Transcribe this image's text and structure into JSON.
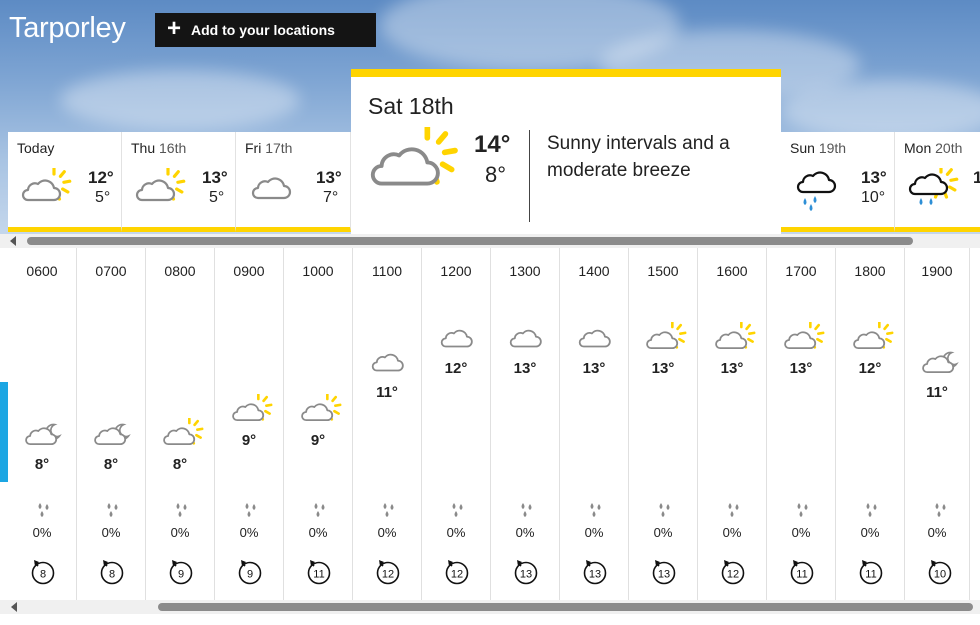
{
  "header": {
    "location_title": "Tarporley",
    "add_button_label": "Add to your locations"
  },
  "days": [
    {
      "name": "Today",
      "date": "",
      "high": "12°",
      "low": "5°",
      "icon": "sunny-intervals-icon"
    },
    {
      "name": "Thu",
      "date": "16th",
      "high": "13°",
      "low": "5°",
      "icon": "sunny-intervals-icon"
    },
    {
      "name": "Fri",
      "date": "17th",
      "high": "13°",
      "low": "7°",
      "icon": "cloud-icon"
    },
    {
      "name": "Sun",
      "date": "19th",
      "high": "13°",
      "low": "10°",
      "icon": "rain-icon"
    },
    {
      "name": "Mon",
      "date": "20th",
      "high": "1",
      "low": "",
      "icon": "sunny-rain-icon"
    }
  ],
  "selected_day": {
    "name": "Sat 18th",
    "high": "14°",
    "low": "8°",
    "description": "Sunny intervals and a moderate breeze",
    "icon": "sunny-intervals-icon"
  },
  "hours": [
    {
      "time": "0600",
      "temp": "8°",
      "temp_value": 8,
      "icon": "cloud-moon-icon",
      "rain": "0%",
      "wind": "8"
    },
    {
      "time": "0700",
      "temp": "8°",
      "temp_value": 8,
      "icon": "cloud-moon-icon",
      "rain": "0%",
      "wind": "8"
    },
    {
      "time": "0800",
      "temp": "8°",
      "temp_value": 8,
      "icon": "sunny-intervals-icon",
      "rain": "0%",
      "wind": "9"
    },
    {
      "time": "0900",
      "temp": "9°",
      "temp_value": 9,
      "icon": "sunny-intervals-icon",
      "rain": "0%",
      "wind": "9"
    },
    {
      "time": "1000",
      "temp": "9°",
      "temp_value": 9,
      "icon": "sunny-intervals-icon",
      "rain": "0%",
      "wind": "11"
    },
    {
      "time": "1100",
      "temp": "11°",
      "temp_value": 11,
      "icon": "cloud-icon",
      "rain": "0%",
      "wind": "12"
    },
    {
      "time": "1200",
      "temp": "12°",
      "temp_value": 12,
      "icon": "cloud-icon",
      "rain": "0%",
      "wind": "12"
    },
    {
      "time": "1300",
      "temp": "13°",
      "temp_value": 13,
      "icon": "cloud-icon",
      "rain": "0%",
      "wind": "13"
    },
    {
      "time": "1400",
      "temp": "13°",
      "temp_value": 13,
      "icon": "cloud-icon",
      "rain": "0%",
      "wind": "13"
    },
    {
      "time": "1500",
      "temp": "13°",
      "temp_value": 13,
      "icon": "sunny-intervals-icon",
      "rain": "0%",
      "wind": "13"
    },
    {
      "time": "1600",
      "temp": "13°",
      "temp_value": 13,
      "icon": "sunny-intervals-icon",
      "rain": "0%",
      "wind": "12"
    },
    {
      "time": "1700",
      "temp": "13°",
      "temp_value": 13,
      "icon": "sunny-intervals-icon",
      "rain": "0%",
      "wind": "11"
    },
    {
      "time": "1800",
      "temp": "12°",
      "temp_value": 12,
      "icon": "sunny-intervals-icon",
      "rain": "0%",
      "wind": "11"
    },
    {
      "time": "1900",
      "temp": "11°",
      "temp_value": 11,
      "icon": "cloud-moon-icon",
      "rain": "0%",
      "wind": "10"
    }
  ],
  "colors": {
    "accent_yellow": "#ffd400",
    "now_marker_blue": "#1ca6e3",
    "rain_blue": "#2e8fd6",
    "icon_grey": "#8a8a8a",
    "button_bg": "#141414"
  }
}
